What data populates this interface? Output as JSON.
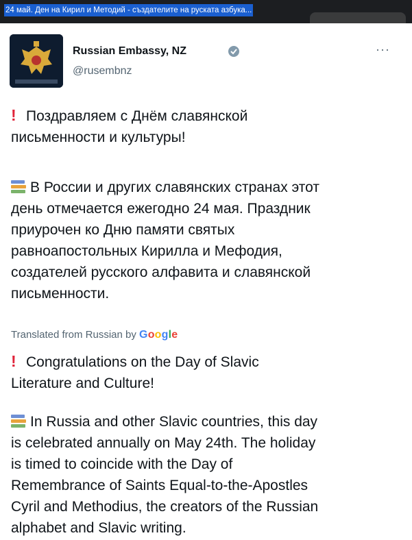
{
  "window": {
    "title": "24 май. Ден на Кирил и Методий - създателите на руската азбука..."
  },
  "tweet": {
    "author_name": "Russian Embassy, NZ",
    "handle": "@rusembnz",
    "more_label": "···",
    "original": {
      "line1": "Поздравляем с Днём славянской",
      "line2": "письменности и культуры!",
      "para2": [
        "В России и других славянских странах этот",
        "день отмечается ежегодно 24 мая. Праздник",
        "приурочен ко Дню памяти святых",
        "равноапостольных Кирилла и Мефодия,",
        "создателей русского алфавита и славянской",
        "письменности."
      ]
    },
    "translated_by": "Translated from Russian by",
    "google_letters": [
      "G",
      "o",
      "o",
      "g",
      "l",
      "e"
    ],
    "translation": {
      "line1": "Congratulations on the Day of Slavic",
      "line2": "Literature and Culture!",
      "para2": [
        "In Russia and other Slavic countries, this day",
        "is celebrated annually on May 24th. The holiday",
        "is timed to coincide with the Day of",
        "Remembrance of Saints Equal-to-the-Apostles",
        "Cyril and Methodius, the creators of the Russian",
        "alphabet and Slavic writing."
      ]
    }
  },
  "icons": {
    "exclamation": "!",
    "books": "books-icon",
    "verified": "verified-badge-icon"
  },
  "colors": {
    "title_bg": "#1a5fd0",
    "accent_red": "#e0243a",
    "muted": "#536471"
  }
}
